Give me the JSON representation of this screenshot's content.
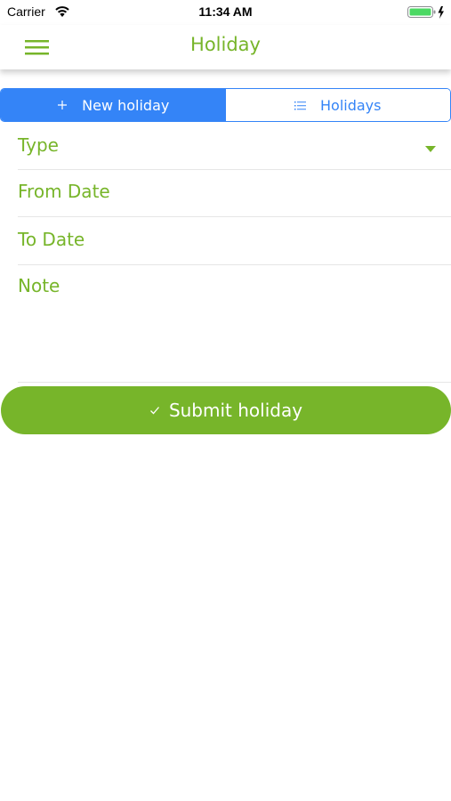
{
  "status_bar": {
    "carrier": "Carrier",
    "time": "11:34 AM",
    "battery_color": "#4cd964"
  },
  "nav": {
    "title": "Holiday",
    "menu_icon": "hamburger-menu-icon"
  },
  "segment": {
    "tabs": [
      {
        "label": "New holiday",
        "icon": "plus-icon",
        "active": true
      },
      {
        "label": "Holidays",
        "icon": "list-icon",
        "active": false
      }
    ]
  },
  "form": {
    "type_label": "Type",
    "from_label": "From Date",
    "to_label": "To Date",
    "note_label": "Note"
  },
  "submit": {
    "label": "Submit holiday",
    "icon": "checkmark-icon"
  },
  "colors": {
    "accent_green": "#77b52a",
    "accent_blue": "#3484f7"
  }
}
